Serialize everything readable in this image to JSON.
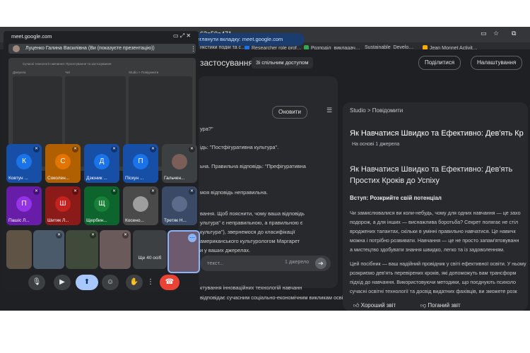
{
  "browser": {
    "url_fragment": "62e50a471",
    "bookmarks": [
      "нкстики подій та с…",
      "Researcher role prof…",
      "Розподіл_викладач…",
      "Sustainable_Develo…",
      "Jean Monnet Activit…"
    ],
    "share_notice": "переглянути вкладку: meet.google.com"
  },
  "app": {
    "title": "застосування",
    "shared_badge": "Зі спільним доступом",
    "share_button": "Поділитися",
    "settings_button": "Налаштування",
    "refresh_button": "Оновити",
    "chat_lines": [
      "ура?\"",
      "ідь: \"Постфігуративна культура\".",
      "ьна. Правильна відповідь: \"Префігуративна",
      "моя відповідь неправильна.",
      "вання. Щоб пояснити, чому ваша відповідь",
      "ультура\" є неправильною, а правильною є",
      "культура\"), звернемося до класифікації",
      "американського культурологом Маргарет",
      "и у ваших джерелах."
    ],
    "chat_input_placeholder": "текст...",
    "sources_count": "1 джерело",
    "footer_line_1": "ктування інноваційних технологій навчанн",
    "footer_line_2": "відповідає сучасним соціально-економічним викликам осві"
  },
  "studio": {
    "breadcrumb": "Studio > Повідомити",
    "title": "Як Навчатися Швидко та Ефективно: Дев'ять Кр",
    "subtitle": "На основі 1 джерела",
    "doc_title": "Як Навчатися Швидко та Ефективно: Дев'ять Простих Кроків до Успіху",
    "intro_heading": "Вступ: Розкрийте свій потенціал",
    "para_lines": [
      "Чи замислювалися ви коли-небудь, чому для одних навчання — це захо",
      "подорож, а для інших — виснажлива боротьба? Секрет полягає не стіл",
      "вроджених талантах, скільки в умінні правильно навчатися. Це навичк",
      "можна і потрібно розвивати. Навчання — це не просто запам'ятовуванн",
      "а мистецтво здобувати знання швидко, легко та із задоволенням.",
      "Цей посібник — ваш надійний провідник у світі ефективної освіти. У ньому",
      "розкриємо дев'ять перевірених кроків, які допоможуть вам трансформ",
      "підхід до навчання. Використовуючи методики, що поєднують психоло",
      "сучасні освітні технології та досвід видатних фахівців, ви зможете розк"
    ],
    "good_report": "Хороший звіт",
    "bad_report": "Поганий звіт"
  },
  "meet": {
    "window_title": "meet.google.com",
    "presenter_label": "Луценко Галина Василівна (Ви (показуєте презентацію))",
    "preview_lines": [
      "Сучасні технології навчання: Проєктування та застосування",
      "Джерела",
      "Чат",
      "Studio > Повідомити"
    ],
    "participants": [
      {
        "initial": "К",
        "name": "Ковтун ...",
        "color": "#1a73e8"
      },
      {
        "initial": "С",
        "name": "Соколен...",
        "color": "#e37400"
      },
      {
        "initial": "Д",
        "name": "Дзюник ...",
        "color": "#1a73e8"
      },
      {
        "initial": "П",
        "name": "Піскун ...",
        "color": "#1a73e8"
      },
      {
        "initial": "",
        "name": "Гальчен...",
        "color": "#7b5e57"
      },
      {
        "initial": "П",
        "name": "Пашіс Л...",
        "color": "#9334e6"
      },
      {
        "initial": "Ш",
        "name": "Шитик Л...",
        "color": "#c5221f"
      },
      {
        "initial": "Щ",
        "name": "Щербин...",
        "color": "#188038"
      },
      {
        "initial": "",
        "name": "Косено...",
        "color": "#6d6d6d"
      },
      {
        "initial": "",
        "name": "Третяк Н...",
        "color": "#5c6b8a"
      }
    ],
    "more_label": "Ще 40 осіб"
  }
}
